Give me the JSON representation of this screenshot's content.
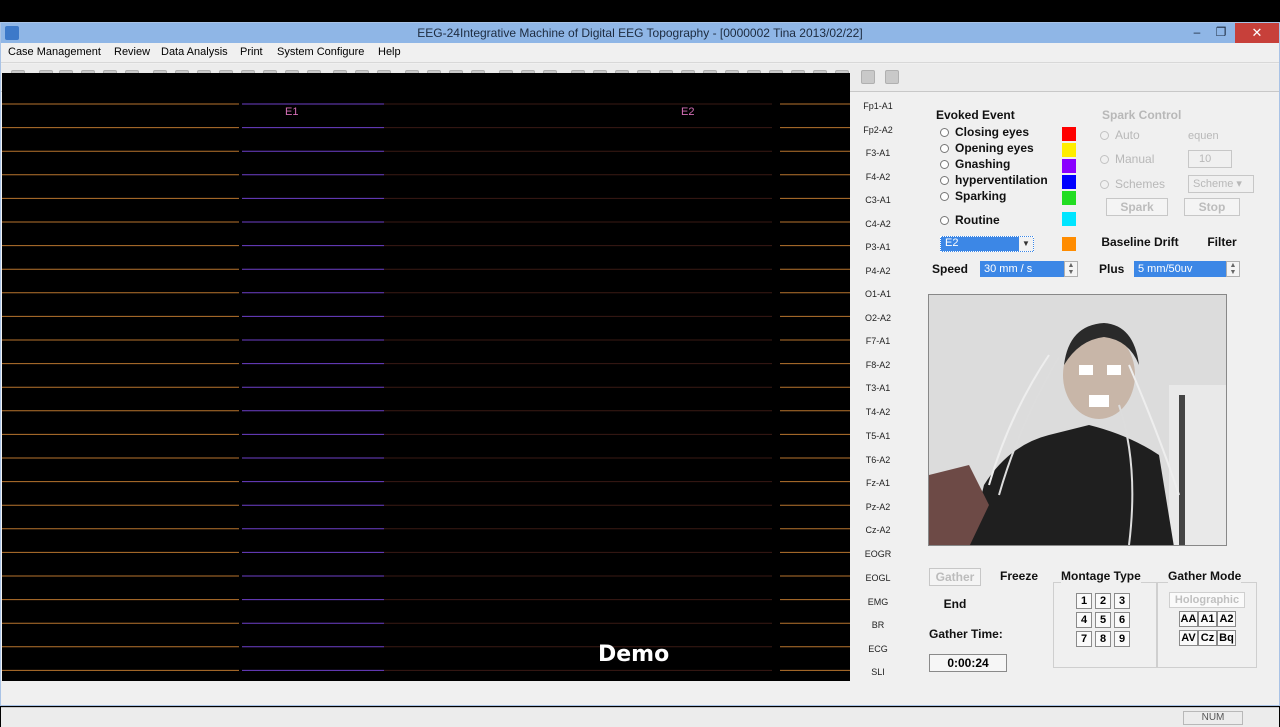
{
  "window": {
    "title": "EEG-24Integrative Machine of Digital EEG Topography - [0000002 Tina 2013/02/22]",
    "minimize": "–",
    "restore": "❐",
    "close": "✕"
  },
  "menu": [
    "Case Management",
    "Review",
    "Data Analysis",
    "Print",
    "System Configure",
    "Help"
  ],
  "eeg": {
    "event_markers": [
      "E1",
      "E2"
    ],
    "channels": [
      "Fp1-A1",
      "Fp2-A2",
      "F3-A1",
      "F4-A2",
      "C3-A1",
      "C4-A2",
      "P3-A1",
      "P4-A2",
      "O1-A1",
      "O2-A2",
      "F7-A1",
      "F8-A2",
      "T3-A1",
      "T4-A2",
      "T5-A1",
      "T6-A2",
      "Fz-A1",
      "Pz-A2",
      "Cz-A2",
      "EOGR",
      "EOGL",
      "EMG",
      "BR",
      "ECG",
      "SLI"
    ]
  },
  "evoked": {
    "title": "Evoked Event",
    "items": [
      {
        "label": "Closing eyes",
        "color": "#ff0000"
      },
      {
        "label": "Opening eyes",
        "color": "#ffee00"
      },
      {
        "label": "Gnashing",
        "color": "#8a00ff"
      },
      {
        "label": "hyperventilation",
        "color": "#0000ff"
      },
      {
        "label": "Sparking",
        "color": "#22dd22"
      },
      {
        "label": "Routine",
        "color": "#00e5ff"
      }
    ],
    "event_select": "E2",
    "event_color": "#ff8c00"
  },
  "spark": {
    "title": "Spark Control",
    "auto": "Auto",
    "manual": "Manual",
    "schemes": "Schemes",
    "frequency_label": "equen",
    "frequency_value": "10",
    "scheme_select": "Scheme",
    "spark_btn": "Spark",
    "stop_btn": "Stop"
  },
  "tabs": {
    "baseline": "Baseline Drift",
    "filter": "Filter"
  },
  "speed": {
    "label": "Speed",
    "value": "30 mm / s"
  },
  "plus": {
    "label": "Plus",
    "value": "5 mm/50uv"
  },
  "controls": {
    "gather": "Gather",
    "freeze": "Freeze",
    "end": "End",
    "gather_time_label": "Gather Time:",
    "gather_time": "0:00:24"
  },
  "montage": {
    "title": "Montage Type",
    "buttons": [
      "1",
      "2",
      "3",
      "4",
      "5",
      "6",
      "7",
      "8",
      "9"
    ]
  },
  "gather_mode": {
    "title": "Gather Mode",
    "holographic": "Holographic",
    "row1": [
      "AA",
      "A1",
      "A2"
    ],
    "row2": [
      "AV",
      "Cz",
      "Bq"
    ]
  },
  "status": {
    "num": "NUM"
  },
  "overlay": {
    "caption": "Demo"
  },
  "colors": {
    "title_bar": "#8fb6e6",
    "eeg_bg": "#000000",
    "trace_orange": "#d9822b",
    "trace_purple": "#7a3ed6"
  }
}
